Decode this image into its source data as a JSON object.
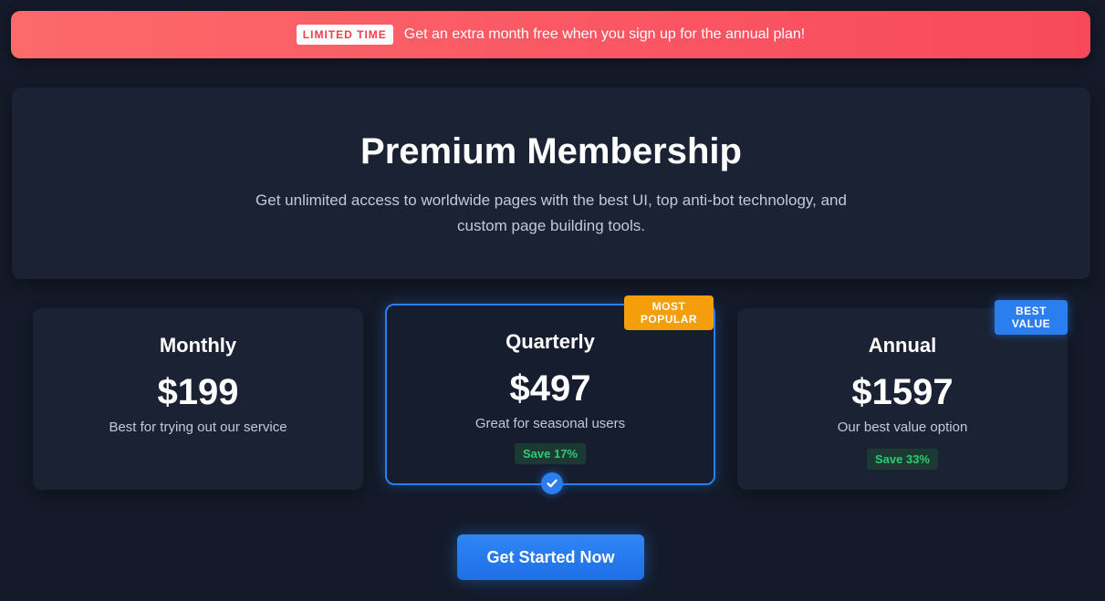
{
  "banner": {
    "badge": "LIMITED TIME",
    "text": "Get an extra month free when you sign up for the annual plan!"
  },
  "hero": {
    "title": "Premium Membership",
    "description": "Get unlimited access to worldwide pages with the best UI, top anti-bot technology, and custom page building tools."
  },
  "plans": [
    {
      "name": "Monthly",
      "price": "$199",
      "description": "Best for trying out our service",
      "save": "",
      "tag": "",
      "selected": false
    },
    {
      "name": "Quarterly",
      "price": "$497",
      "description": "Great for seasonal users",
      "save": "Save 17%",
      "tag": "MOST POPULAR",
      "selected": true
    },
    {
      "name": "Annual",
      "price": "$1597",
      "description": "Our best value option",
      "save": "Save 33%",
      "tag": "BEST VALUE",
      "selected": false
    }
  ],
  "cta": {
    "label": "Get Started Now"
  },
  "colors": {
    "accent": "#2b7ef0",
    "banner": "#fa5563",
    "popular_tag": "#f59e0b",
    "save_text": "#2ecc71",
    "background": "#141a29"
  },
  "icons": {
    "selected_check": "check-circle-icon"
  }
}
